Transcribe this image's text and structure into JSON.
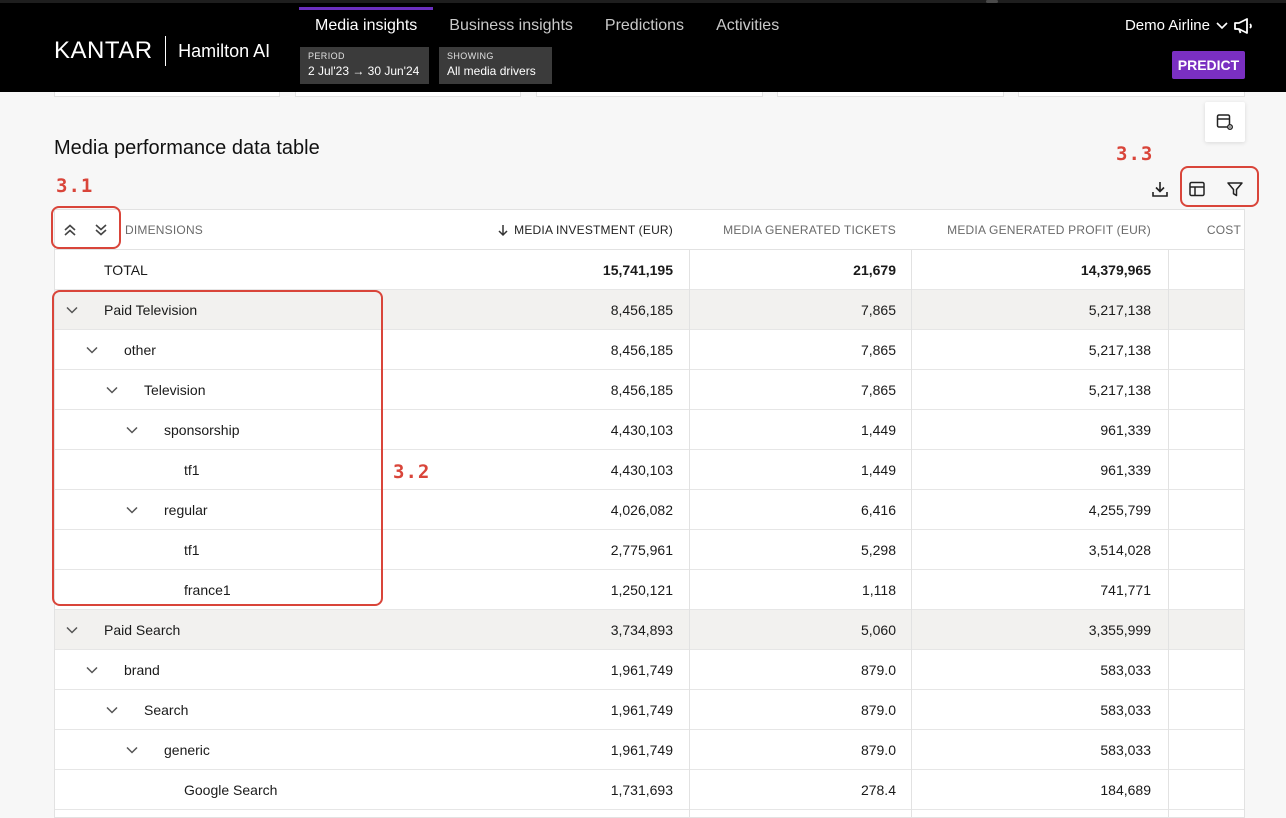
{
  "header": {
    "brand": "KANTAR",
    "product": "Hamilton AI",
    "tabs": [
      {
        "label": "Media insights",
        "active": true
      },
      {
        "label": "Business insights",
        "active": false
      },
      {
        "label": "Predictions",
        "active": false
      },
      {
        "label": "Activities",
        "active": false
      }
    ],
    "period": {
      "key": "PERIOD",
      "value": "2 Jul'23 → 30 Jun'24"
    },
    "showing": {
      "key": "SHOWING",
      "value": "All media drivers"
    },
    "account": "Demo Airline",
    "predict_label": "PREDICT",
    "accent_color": "#7a2fc1"
  },
  "section": {
    "title": "Media performance data table"
  },
  "annotations": [
    {
      "id": "3.1",
      "label": "3.1"
    },
    {
      "id": "3.2",
      "label": "3.2"
    },
    {
      "id": "3.3",
      "label": "3.3"
    }
  ],
  "toolbar": {
    "icons": [
      "download-icon",
      "table-layout-icon",
      "filter-icon",
      "table-settings-icon"
    ]
  },
  "table": {
    "columns": {
      "dimensions": "DIMENSIONS",
      "investment": "MEDIA INVESTMENT (EUR)",
      "tickets": "MEDIA GENERATED TICKETS",
      "profit": "MEDIA GENERATED PROFIT (EUR)",
      "cost": "COST"
    },
    "sort": {
      "column": "investment",
      "direction": "descending"
    },
    "rows": [
      {
        "label": "TOTAL",
        "level": 0,
        "expandable": false,
        "group": false,
        "total": true,
        "investment": "15,741,195",
        "tickets": "21,679",
        "profit": "14,379,965"
      },
      {
        "label": "Paid Television",
        "level": 0,
        "expandable": true,
        "group": true,
        "investment": "8,456,185",
        "tickets": "7,865",
        "profit": "5,217,138"
      },
      {
        "label": "other",
        "level": 1,
        "expandable": true,
        "group": false,
        "investment": "8,456,185",
        "tickets": "7,865",
        "profit": "5,217,138"
      },
      {
        "label": "Television",
        "level": 2,
        "expandable": true,
        "group": false,
        "investment": "8,456,185",
        "tickets": "7,865",
        "profit": "5,217,138"
      },
      {
        "label": "sponsorship",
        "level": 3,
        "expandable": true,
        "group": false,
        "investment": "4,430,103",
        "tickets": "1,449",
        "profit": "961,339"
      },
      {
        "label": "tf1",
        "level": 4,
        "expandable": false,
        "group": false,
        "investment": "4,430,103",
        "tickets": "1,449",
        "profit": "961,339"
      },
      {
        "label": "regular",
        "level": 3,
        "expandable": true,
        "group": false,
        "investment": "4,026,082",
        "tickets": "6,416",
        "profit": "4,255,799"
      },
      {
        "label": "tf1",
        "level": 4,
        "expandable": false,
        "group": false,
        "investment": "2,775,961",
        "tickets": "5,298",
        "profit": "3,514,028"
      },
      {
        "label": "france1",
        "level": 4,
        "expandable": false,
        "group": false,
        "investment": "1,250,121",
        "tickets": "1,118",
        "profit": "741,771"
      },
      {
        "label": "Paid Search",
        "level": 0,
        "expandable": true,
        "group": true,
        "investment": "3,734,893",
        "tickets": "5,060",
        "profit": "3,355,999"
      },
      {
        "label": "brand",
        "level": 1,
        "expandable": true,
        "group": false,
        "investment": "1,961,749",
        "tickets": "879.0",
        "profit": "583,033"
      },
      {
        "label": "Search",
        "level": 2,
        "expandable": true,
        "group": false,
        "investment": "1,961,749",
        "tickets": "879.0",
        "profit": "583,033"
      },
      {
        "label": "generic",
        "level": 3,
        "expandable": true,
        "group": false,
        "investment": "1,961,749",
        "tickets": "879.0",
        "profit": "583,033"
      },
      {
        "label": "Google Search",
        "level": 4,
        "expandable": false,
        "group": false,
        "investment": "1,731,693",
        "tickets": "278.4",
        "profit": "184,689"
      },
      {
        "label": "",
        "level": 4,
        "expandable": false,
        "group": false,
        "investment": "",
        "tickets": "",
        "profit": ""
      }
    ]
  }
}
